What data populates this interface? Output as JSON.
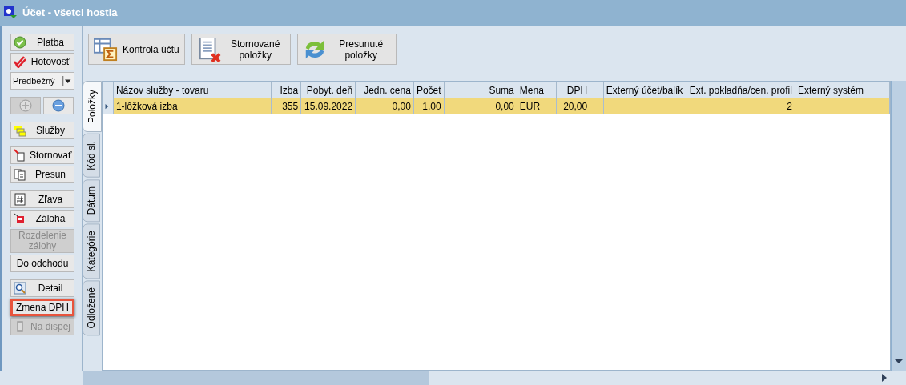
{
  "window": {
    "title": "Účet - všetci hostia"
  },
  "sidebar": {
    "groups": [
      [
        {
          "kind": "button",
          "label": "Platba",
          "disabled": false,
          "highlighted": false
        },
        {
          "kind": "button",
          "label": "Hotovosť",
          "disabled": false,
          "highlighted": false
        },
        {
          "kind": "dropdown",
          "label": "Predbežný"
        }
      ],
      [
        {
          "kind": "iconpair",
          "disabled_plus": true,
          "disabled_minus": false
        }
      ],
      [
        {
          "kind": "button",
          "label": "Služby",
          "disabled": false,
          "highlighted": false
        }
      ],
      [
        {
          "kind": "button",
          "label": "Stornovať",
          "disabled": false,
          "highlighted": false
        },
        {
          "kind": "button",
          "label": "Presun",
          "disabled": false,
          "highlighted": false
        }
      ],
      [
        {
          "kind": "button",
          "label": "Zľava",
          "disabled": false,
          "highlighted": false
        },
        {
          "kind": "button",
          "label": "Záloha",
          "disabled": false,
          "highlighted": false
        },
        {
          "kind": "button",
          "label": "Rozdelenie zálohy",
          "disabled": true,
          "highlighted": false
        },
        {
          "kind": "button",
          "label": "Do odchodu",
          "disabled": false,
          "highlighted": false
        }
      ],
      [
        {
          "kind": "button",
          "label": "Detail",
          "disabled": false,
          "highlighted": false
        },
        {
          "kind": "button",
          "label": "Zmena DPH",
          "disabled": false,
          "highlighted": true
        },
        {
          "kind": "button",
          "label": "Na dispej",
          "disabled": true,
          "highlighted": false
        }
      ]
    ]
  },
  "toolbar": [
    {
      "label": "Kontrola účtu"
    },
    {
      "label": "Stornované položky"
    },
    {
      "label": "Presunuté položky"
    }
  ],
  "tabs": [
    {
      "label": "Položky",
      "selected": true
    },
    {
      "label": "Kód sl.",
      "selected": false
    },
    {
      "label": "Dátum",
      "selected": false
    },
    {
      "label": "Kategórie",
      "selected": false
    },
    {
      "label": "Odložené",
      "selected": false
    }
  ],
  "table": {
    "columns": [
      "Názov služby - tovaru",
      "Izba",
      "Pobyt. deň",
      "Jedn. cena",
      "Počet",
      "Suma",
      "Mena",
      "DPH",
      "",
      "Externý účet/balík",
      "Ext. pokladňa/cen. profil",
      "Externý systém"
    ],
    "rows": [
      {
        "selected": true,
        "cells": [
          "1-lôžková izba",
          "355",
          "15.09.2022",
          "0,00",
          "1,00",
          "0,00",
          "EUR",
          "20,00",
          "",
          "",
          "2",
          ""
        ]
      }
    ]
  }
}
